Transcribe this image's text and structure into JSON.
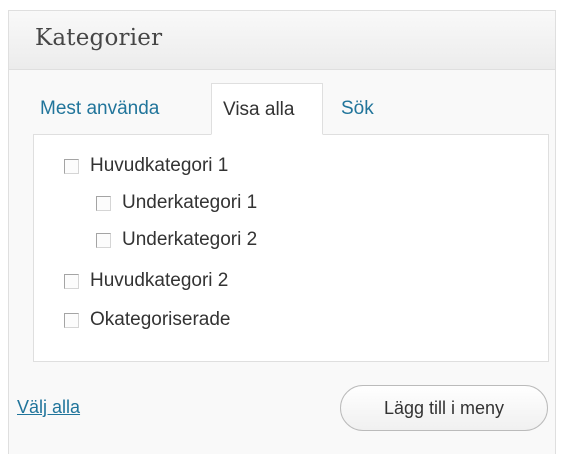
{
  "panel": {
    "title": "Kategorier"
  },
  "tabs": [
    {
      "label": "Mest använda",
      "active": false
    },
    {
      "label": "Visa alla",
      "active": true
    },
    {
      "label": "Sök",
      "active": false
    }
  ],
  "categories": [
    {
      "label": "Huvudkategori 1",
      "level": 0,
      "checked": false
    },
    {
      "label": "Underkategori 1",
      "level": 1,
      "checked": false
    },
    {
      "label": "Underkategori 2",
      "level": 1,
      "checked": false
    },
    {
      "label": "Huvudkategori 2",
      "level": 0,
      "checked": false
    },
    {
      "label": "Okategoriserade",
      "level": 0,
      "checked": false
    }
  ],
  "footer": {
    "select_all_label": "Välj alla",
    "add_button_label": "Lägg till i meny"
  },
  "colors": {
    "link": "#21759b",
    "text": "#333333",
    "border": "#dfdfdf",
    "panel_background": "#f9f9f9"
  }
}
